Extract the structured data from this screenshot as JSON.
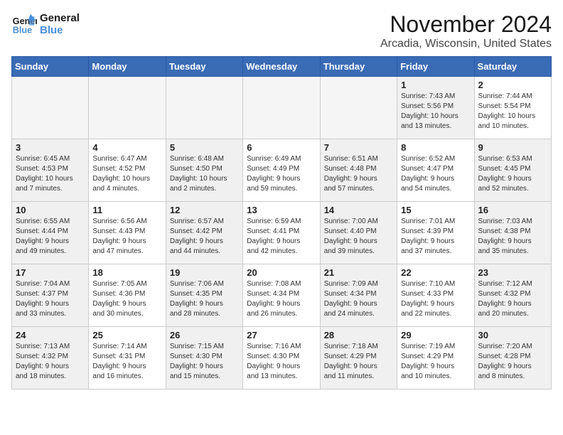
{
  "logo": {
    "line1": "General",
    "line2": "Blue"
  },
  "title": "November 2024",
  "location": "Arcadia, Wisconsin, United States",
  "days_header": [
    "Sunday",
    "Monday",
    "Tuesday",
    "Wednesday",
    "Thursday",
    "Friday",
    "Saturday"
  ],
  "weeks": [
    [
      {
        "day": "",
        "info": "",
        "empty": true
      },
      {
        "day": "",
        "info": "",
        "empty": true
      },
      {
        "day": "",
        "info": "",
        "empty": true
      },
      {
        "day": "",
        "info": "",
        "empty": true
      },
      {
        "day": "",
        "info": "",
        "empty": true
      },
      {
        "day": "1",
        "info": "Sunrise: 7:43 AM\nSunset: 5:56 PM\nDaylight: 10 hours\nand 13 minutes.",
        "shaded": true
      },
      {
        "day": "2",
        "info": "Sunrise: 7:44 AM\nSunset: 5:54 PM\nDaylight: 10 hours\nand 10 minutes."
      }
    ],
    [
      {
        "day": "3",
        "info": "Sunrise: 6:45 AM\nSunset: 4:53 PM\nDaylight: 10 hours\nand 7 minutes.",
        "shaded": true
      },
      {
        "day": "4",
        "info": "Sunrise: 6:47 AM\nSunset: 4:52 PM\nDaylight: 10 hours\nand 4 minutes."
      },
      {
        "day": "5",
        "info": "Sunrise: 6:48 AM\nSunset: 4:50 PM\nDaylight: 10 hours\nand 2 minutes.",
        "shaded": true
      },
      {
        "day": "6",
        "info": "Sunrise: 6:49 AM\nSunset: 4:49 PM\nDaylight: 9 hours\nand 59 minutes."
      },
      {
        "day": "7",
        "info": "Sunrise: 6:51 AM\nSunset: 4:48 PM\nDaylight: 9 hours\nand 57 minutes.",
        "shaded": true
      },
      {
        "day": "8",
        "info": "Sunrise: 6:52 AM\nSunset: 4:47 PM\nDaylight: 9 hours\nand 54 minutes."
      },
      {
        "day": "9",
        "info": "Sunrise: 6:53 AM\nSunset: 4:45 PM\nDaylight: 9 hours\nand 52 minutes.",
        "shaded": true
      }
    ],
    [
      {
        "day": "10",
        "info": "Sunrise: 6:55 AM\nSunset: 4:44 PM\nDaylight: 9 hours\nand 49 minutes.",
        "shaded": true
      },
      {
        "day": "11",
        "info": "Sunrise: 6:56 AM\nSunset: 4:43 PM\nDaylight: 9 hours\nand 47 minutes."
      },
      {
        "day": "12",
        "info": "Sunrise: 6:57 AM\nSunset: 4:42 PM\nDaylight: 9 hours\nand 44 minutes.",
        "shaded": true
      },
      {
        "day": "13",
        "info": "Sunrise: 6:59 AM\nSunset: 4:41 PM\nDaylight: 9 hours\nand 42 minutes."
      },
      {
        "day": "14",
        "info": "Sunrise: 7:00 AM\nSunset: 4:40 PM\nDaylight: 9 hours\nand 39 minutes.",
        "shaded": true
      },
      {
        "day": "15",
        "info": "Sunrise: 7:01 AM\nSunset: 4:39 PM\nDaylight: 9 hours\nand 37 minutes."
      },
      {
        "day": "16",
        "info": "Sunrise: 7:03 AM\nSunset: 4:38 PM\nDaylight: 9 hours\nand 35 minutes.",
        "shaded": true
      }
    ],
    [
      {
        "day": "17",
        "info": "Sunrise: 7:04 AM\nSunset: 4:37 PM\nDaylight: 9 hours\nand 33 minutes.",
        "shaded": true
      },
      {
        "day": "18",
        "info": "Sunrise: 7:05 AM\nSunset: 4:36 PM\nDaylight: 9 hours\nand 30 minutes."
      },
      {
        "day": "19",
        "info": "Sunrise: 7:06 AM\nSunset: 4:35 PM\nDaylight: 9 hours\nand 28 minutes.",
        "shaded": true
      },
      {
        "day": "20",
        "info": "Sunrise: 7:08 AM\nSunset: 4:34 PM\nDaylight: 9 hours\nand 26 minutes."
      },
      {
        "day": "21",
        "info": "Sunrise: 7:09 AM\nSunset: 4:34 PM\nDaylight: 9 hours\nand 24 minutes.",
        "shaded": true
      },
      {
        "day": "22",
        "info": "Sunrise: 7:10 AM\nSunset: 4:33 PM\nDaylight: 9 hours\nand 22 minutes."
      },
      {
        "day": "23",
        "info": "Sunrise: 7:12 AM\nSunset: 4:32 PM\nDaylight: 9 hours\nand 20 minutes.",
        "shaded": true
      }
    ],
    [
      {
        "day": "24",
        "info": "Sunrise: 7:13 AM\nSunset: 4:32 PM\nDaylight: 9 hours\nand 18 minutes.",
        "shaded": true
      },
      {
        "day": "25",
        "info": "Sunrise: 7:14 AM\nSunset: 4:31 PM\nDaylight: 9 hours\nand 16 minutes."
      },
      {
        "day": "26",
        "info": "Sunrise: 7:15 AM\nSunset: 4:30 PM\nDaylight: 9 hours\nand 15 minutes.",
        "shaded": true
      },
      {
        "day": "27",
        "info": "Sunrise: 7:16 AM\nSunset: 4:30 PM\nDaylight: 9 hours\nand 13 minutes."
      },
      {
        "day": "28",
        "info": "Sunrise: 7:18 AM\nSunset: 4:29 PM\nDaylight: 9 hours\nand 11 minutes.",
        "shaded": true
      },
      {
        "day": "29",
        "info": "Sunrise: 7:19 AM\nSunset: 4:29 PM\nDaylight: 9 hours\nand 10 minutes."
      },
      {
        "day": "30",
        "info": "Sunrise: 7:20 AM\nSunset: 4:28 PM\nDaylight: 9 hours\nand 8 minutes.",
        "shaded": true
      }
    ]
  ]
}
